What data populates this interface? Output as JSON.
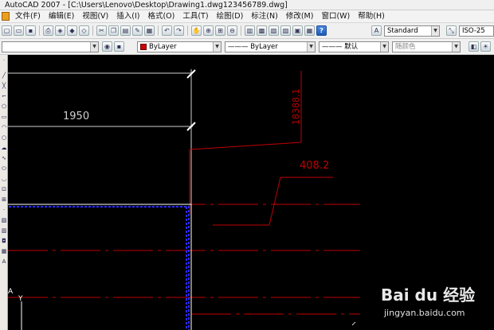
{
  "window": {
    "title": "AutoCAD 2007 - [C:\\Users\\Lenovo\\Desktop\\Drawing1.dwg123456789.dwg]"
  },
  "menu": {
    "items": [
      {
        "label": "文件(F)"
      },
      {
        "label": "编辑(E)"
      },
      {
        "label": "视图(V)"
      },
      {
        "label": "插入(I)"
      },
      {
        "label": "格式(O)"
      },
      {
        "label": "工具(T)"
      },
      {
        "label": "绘图(D)"
      },
      {
        "label": "标注(N)"
      },
      {
        "label": "修改(M)"
      },
      {
        "label": "窗口(W)"
      },
      {
        "label": "帮助(H)"
      }
    ]
  },
  "toolbar": {
    "text_style": "Standard",
    "dim_style": "ISO-25",
    "help_icon": "?"
  },
  "properties": {
    "color": "ByLayer",
    "color_hex": "#d00000",
    "linetype": "ByLayer",
    "lineweight": "默认",
    "plot_style": "随颜色"
  },
  "drawing": {
    "dim_horizontal": "1950",
    "dim_vertical": "18388.1",
    "dim_leader": "408.2",
    "ucs_y_label": "Y",
    "ucs_x_label": "A"
  },
  "colors": {
    "dim_line": "#d0d0d0",
    "red_line": "#c00000",
    "selection": "#2a2aff",
    "background": "#000000"
  },
  "watermark": {
    "brand": "Bai du 经验",
    "url": "jingyan.baidu.com"
  }
}
